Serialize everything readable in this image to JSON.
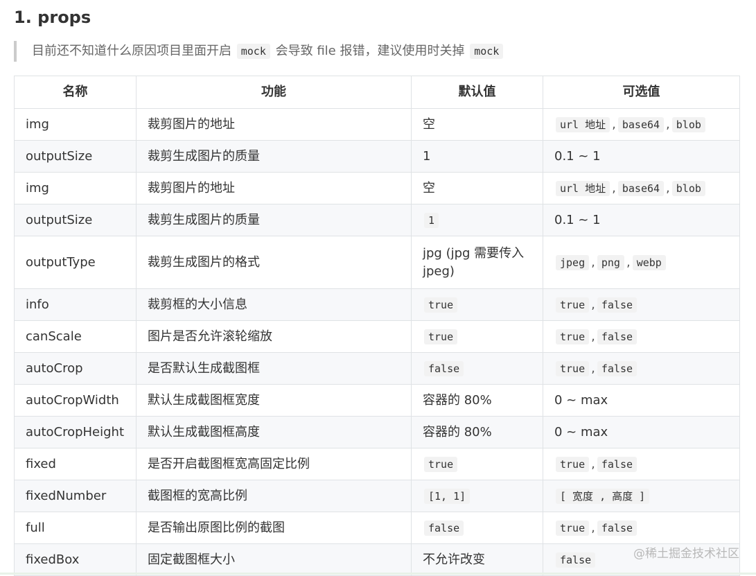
{
  "heading": "1. props",
  "note": {
    "text_before": "目前还不知道什么原因项目里面开启",
    "code1": "mock",
    "text_after": "会导致 file 报错，建议使用时关掉",
    "code2": "mock"
  },
  "table": {
    "headers": [
      "名称",
      "功能",
      "默认值",
      "可选值"
    ],
    "rows": [
      {
        "name": "img",
        "func": "裁剪图片的地址",
        "def": [
          {
            "t": "空"
          }
        ],
        "opt": [
          {
            "c": "url 地址"
          },
          {
            "s": ","
          },
          {
            "c": "base64"
          },
          {
            "s": ","
          },
          {
            "c": "blob"
          }
        ]
      },
      {
        "name": "outputSize",
        "func": "裁剪生成图片的质量",
        "def": [
          {
            "t": "1"
          }
        ],
        "opt": [
          {
            "t": "0.1 ~ 1"
          }
        ]
      },
      {
        "name": "img",
        "func": "裁剪图片的地址",
        "def": [
          {
            "t": "空"
          }
        ],
        "opt": [
          {
            "c": "url 地址"
          },
          {
            "s": ","
          },
          {
            "c": "base64"
          },
          {
            "s": ","
          },
          {
            "c": "blob"
          }
        ]
      },
      {
        "name": "outputSize",
        "func": "裁剪生成图片的质量",
        "def": [
          {
            "c": "1"
          }
        ],
        "opt": [
          {
            "t": "0.1 ~ 1"
          }
        ]
      },
      {
        "name": "outputType",
        "func": "裁剪生成图片的格式",
        "def": [
          {
            "t": "jpg (jpg 需要传入 jpeg)"
          }
        ],
        "opt": [
          {
            "c": "jpeg"
          },
          {
            "s": ","
          },
          {
            "c": "png"
          },
          {
            "s": ","
          },
          {
            "c": "webp"
          }
        ],
        "tall": true
      },
      {
        "name": "info",
        "func": "裁剪框的大小信息",
        "def": [
          {
            "c": "true"
          }
        ],
        "opt": [
          {
            "c": "true"
          },
          {
            "s": ","
          },
          {
            "c": "false"
          }
        ]
      },
      {
        "name": "canScale",
        "func": "图片是否允许滚轮缩放",
        "def": [
          {
            "c": "true"
          }
        ],
        "opt": [
          {
            "c": "true"
          },
          {
            "s": ","
          },
          {
            "c": "false"
          }
        ]
      },
      {
        "name": "autoCrop",
        "func": "是否默认生成截图框",
        "def": [
          {
            "c": "false"
          }
        ],
        "opt": [
          {
            "c": "true"
          },
          {
            "s": ","
          },
          {
            "c": "false"
          }
        ]
      },
      {
        "name": "autoCropWidth",
        "func": "默认生成截图框宽度",
        "def": [
          {
            "t": "容器的 80%"
          }
        ],
        "opt": [
          {
            "t": "0 ~ max"
          }
        ]
      },
      {
        "name": "autoCropHeight",
        "func": "默认生成截图框高度",
        "def": [
          {
            "t": "容器的 80%"
          }
        ],
        "opt": [
          {
            "t": "0 ~ max"
          }
        ]
      },
      {
        "name": "fixed",
        "func": "是否开启截图框宽高固定比例",
        "def": [
          {
            "c": "true"
          }
        ],
        "opt": [
          {
            "c": "true"
          },
          {
            "s": ","
          },
          {
            "c": "false"
          }
        ]
      },
      {
        "name": "fixedNumber",
        "func": "截图框的宽高比例",
        "def": [
          {
            "c": "[1, 1]"
          }
        ],
        "opt": [
          {
            "c": "[ 宽度 , 高度 ]"
          }
        ]
      },
      {
        "name": "full",
        "func": "是否输出原图比例的截图",
        "def": [
          {
            "c": "false"
          }
        ],
        "opt": [
          {
            "c": "true"
          },
          {
            "s": ","
          },
          {
            "c": "false"
          }
        ]
      },
      {
        "name": "fixedBox",
        "func": "固定截图框大小",
        "def": [
          {
            "t": "不允许改变"
          }
        ],
        "opt": [
          {
            "c": "false"
          }
        ]
      }
    ]
  },
  "watermark": "@稀土掘金技术社区"
}
